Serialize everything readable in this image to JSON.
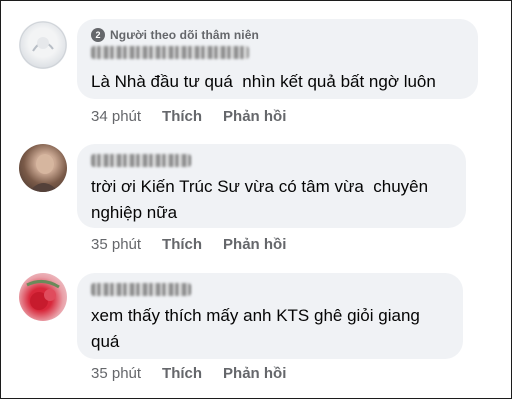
{
  "comments": [
    {
      "badge": "Người theo dõi thâm niên",
      "badge_icon": "2",
      "text": "Là Nhà đầu tư quá  nhìn kết quả bất ngờ luôn",
      "time": "34 phút",
      "like": "Thích",
      "reply": "Phản hồi"
    },
    {
      "text": "trời ơi Kiến Trúc Sư vừa có tâm vừa  chuyên\nnghiệp nữa",
      "time": "35 phút",
      "like": "Thích",
      "reply": "Phản hồi"
    },
    {
      "text": "xem thấy thích mấy anh KTS ghê giỏi giang\nquá",
      "time": "35 phút",
      "like": "Thích",
      "reply": "Phản hồi"
    }
  ]
}
